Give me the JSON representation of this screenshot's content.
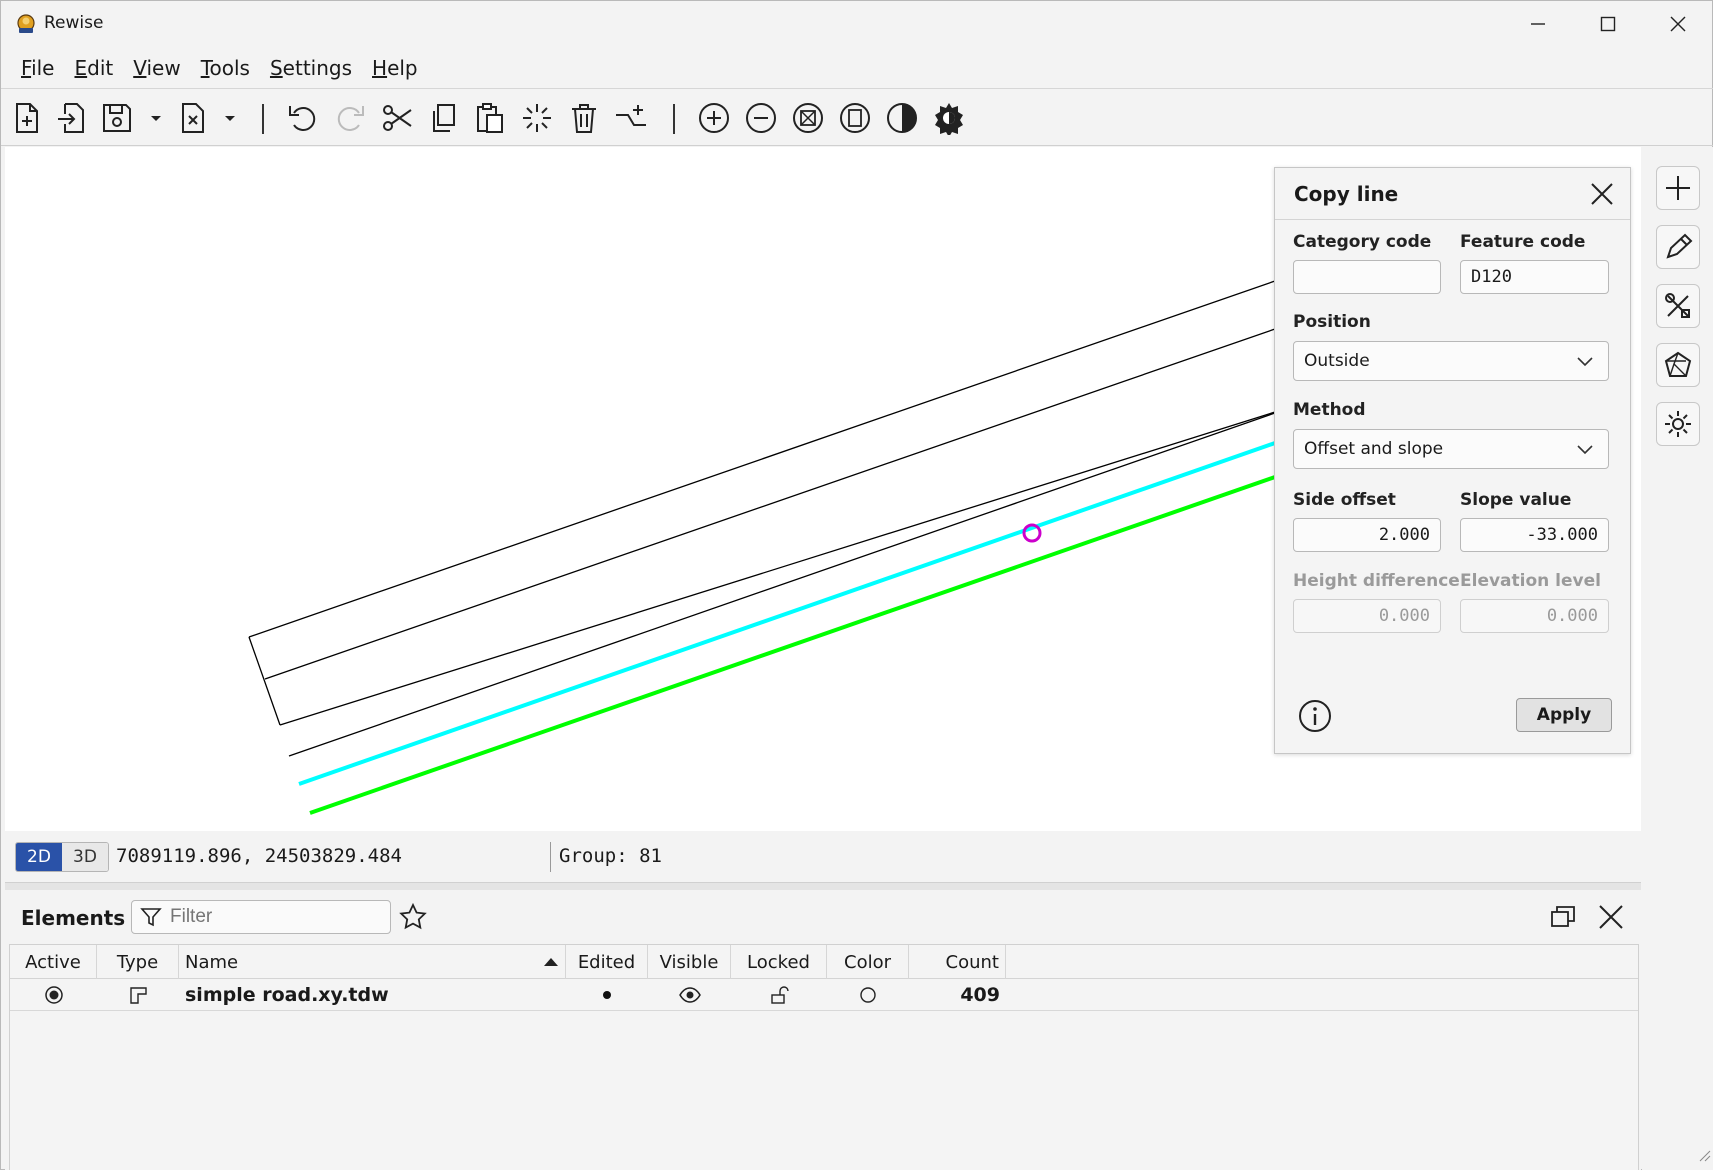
{
  "window": {
    "title": "Rewise"
  },
  "menu": {
    "items": [
      {
        "label": "File",
        "u": "F",
        "rest": "ile"
      },
      {
        "label": "Edit",
        "u": "E",
        "rest": "dit"
      },
      {
        "label": "View",
        "u": "V",
        "rest": "iew"
      },
      {
        "label": "Tools",
        "u": "T",
        "rest": "ools"
      },
      {
        "label": "Settings",
        "u": "S",
        "rest": "ettings"
      },
      {
        "label": "Help",
        "u": "H",
        "rest": "elp"
      }
    ]
  },
  "toolbar": {
    "icons": [
      "new-file-icon",
      "import-icon",
      "save-icon",
      "close-file-icon",
      "undo-icon",
      "redo-icon",
      "cut-icon",
      "copy-icon",
      "paste-icon",
      "select-icon",
      "delete-icon",
      "add-line-icon",
      "zoom-in-icon",
      "zoom-out-icon",
      "zoom-extents-icon",
      "zoom-page-icon",
      "contrast-icon",
      "theme-icon"
    ]
  },
  "canvas": {
    "line_colors": {
      "default": "#000000",
      "selected": "#00ffff",
      "new": "#00ff00",
      "marker": "#cc00cc"
    }
  },
  "copy_line": {
    "title": "Copy line",
    "category_code_label": "Category code",
    "category_code_value": "",
    "feature_code_label": "Feature code",
    "feature_code_value": "D120",
    "position_label": "Position",
    "position_value": "Outside",
    "method_label": "Method",
    "method_value": "Offset and slope",
    "side_offset_label": "Side offset",
    "side_offset_value": "2.000",
    "slope_value_label": "Slope value",
    "slope_value_value": "-33.000",
    "height_difference_label": "Height difference",
    "height_difference_value": "0.000",
    "elevation_level_label": "Elevation level",
    "elevation_level_value": "0.000",
    "apply_label": "Apply"
  },
  "status": {
    "mode_2d": "2D",
    "mode_3d": "3D",
    "active_mode": "2D",
    "coordinates": "7089119.896, 24503829.484",
    "group": "Group: 81"
  },
  "elements": {
    "title": "Elements",
    "filter_placeholder": "Filter",
    "columns": {
      "active": "Active",
      "type": "Type",
      "name": "Name",
      "edited": "Edited",
      "visible": "Visible",
      "locked": "Locked",
      "color": "Color",
      "count": "Count"
    },
    "sort_column": "Name",
    "rows": [
      {
        "name": "simple road.xy.tdw",
        "count": "409",
        "active": true
      }
    ]
  },
  "right_tools": [
    "add-icon",
    "edit-pencil-icon",
    "tools-icon",
    "polygon-icon",
    "settings-gear-icon"
  ]
}
